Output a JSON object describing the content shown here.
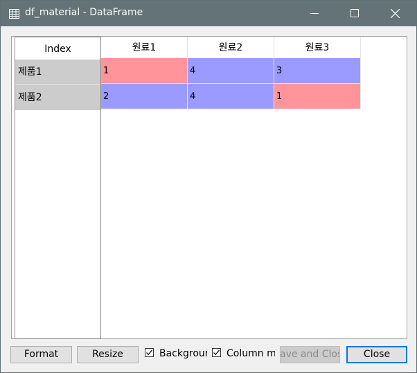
{
  "window": {
    "title": "df_material - DataFrame",
    "title_icon": "table-icon",
    "controls": [
      "minimize-icon",
      "maximize-icon",
      "close-icon"
    ]
  },
  "table": {
    "index_header": "Index",
    "columns": [
      "원료1",
      "원료2",
      "원료3"
    ],
    "rows": [
      {
        "index": "제품1",
        "values": [
          "1",
          "4",
          "3"
        ],
        "colors": [
          "#ff949a",
          "#9a9aff",
          "#9a9aff"
        ]
      },
      {
        "index": "제품2",
        "values": [
          "2",
          "4",
          "1"
        ],
        "colors": [
          "#9a9aff",
          "#9a9aff",
          "#ff949a"
        ]
      }
    ],
    "index_cell_color": "#cccccc"
  },
  "footer": {
    "format_label": "Format",
    "resize_label": "Resize",
    "background_label": "Backgrour",
    "background_checked": true,
    "column_min_label": "Column mi",
    "column_min_checked": true,
    "save_close_label": "ave and Clos",
    "close_label": "Close"
  },
  "colors": {
    "titlebar": "#637378",
    "high_value": "#ff949a",
    "low_value": "#9a9aff",
    "focus_border": "#0078d7"
  }
}
